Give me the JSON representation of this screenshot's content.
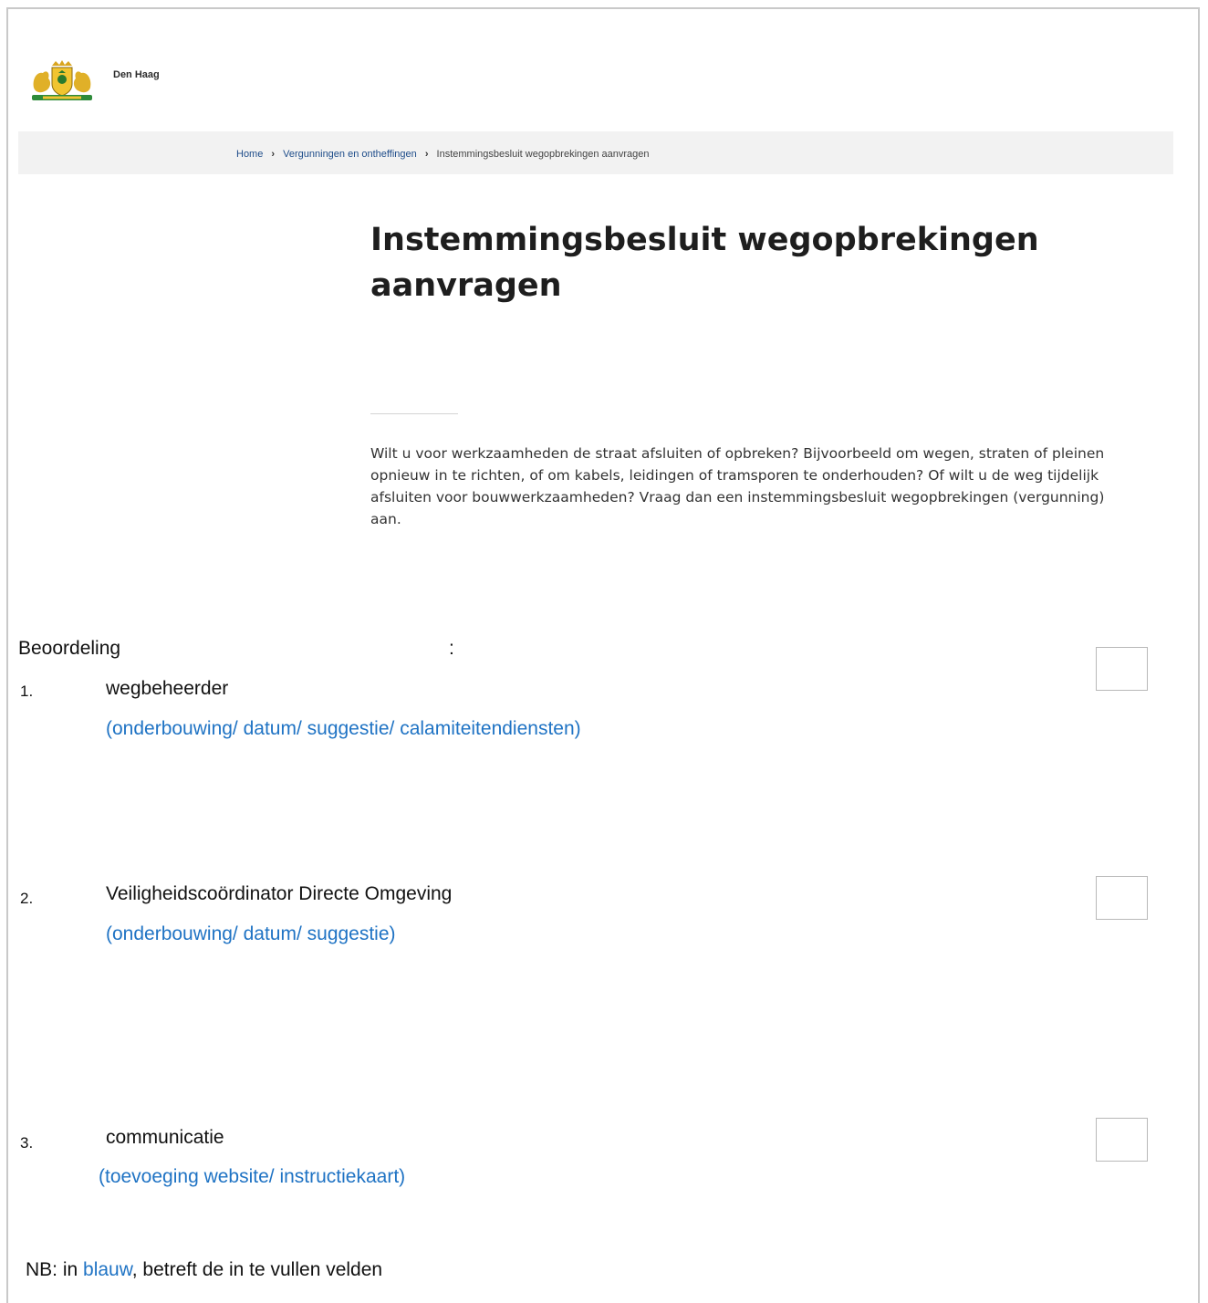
{
  "header": {
    "logo_icon": "den-haag-coat-of-arms-icon",
    "logo_text": "Den Haag"
  },
  "breadcrumb": {
    "home": "Home",
    "separator": "›",
    "section": "Vergunningen en ontheffingen",
    "current": "Instemmingsbesluit wegopbrekingen aanvragen"
  },
  "main": {
    "title": "Instemmingsbesluit wegopbrekingen aanvragen",
    "intro": "Wilt u voor werkzaamheden de straat afsluiten of opbreken? Bijvoorbeeld om wegen, straten of pleinen opnieuw in te richten, of om kabels, leidingen of tramsporen te onderhouden? Of wilt u de weg tijdelijk afsluiten voor bouwwerkzaamheden? Vraag dan een instemmingsbesluit wegopbrekingen (vergunning) aan."
  },
  "assessment": {
    "label": "Beoordeling",
    "colon": ":",
    "items": [
      {
        "number": "1.",
        "label": "wegbeheerder",
        "hint": "(onderbouwing/ datum/ suggestie/ calamiteitendiensten)"
      },
      {
        "number": "2.",
        "label": "Veiligheidscoördinator Directe Omgeving",
        "hint": "(onderbouwing/ datum/ suggestie)"
      },
      {
        "number": "3.",
        "label": "communicatie",
        "hint": "(toevoeging website/ instructiekaart)"
      }
    ]
  },
  "footnote": {
    "prefix": "NB:  in ",
    "blue_word": "blauw",
    "suffix": ", betreft de in te vullen velden"
  },
  "colors": {
    "hint_blue": "#1f73c4",
    "breadcrumb_link": "#1f4d8a",
    "breadcrumb_bg": "#f2f2f2"
  }
}
